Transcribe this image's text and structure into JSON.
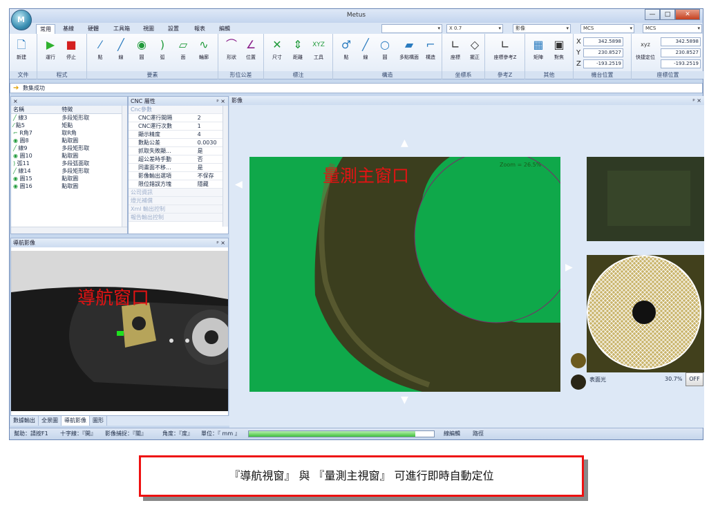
{
  "window": {
    "title": "Metus",
    "app_logo": "M"
  },
  "window_controls": {
    "minimize": "—",
    "maximize": "□",
    "close": "✕"
  },
  "tabs": [
    "常用",
    "基線",
    "硬體",
    "工具箱",
    "視圖",
    "設置",
    "報表",
    "編輯"
  ],
  "combos": {
    "layer": "",
    "x_value": "X  0.7",
    "image_mode": "影像",
    "mcs1": "MCS",
    "mcs2": "MCS"
  },
  "ribbon": {
    "groups": [
      {
        "label": "文件",
        "buttons": [
          "新建",
          "",
          ""
        ]
      },
      {
        "label": "程式",
        "buttons": [
          "運行",
          "停止"
        ]
      },
      {
        "label": "要素",
        "buttons": [
          "點",
          "線",
          "圓",
          "弧",
          "面",
          "輪廓"
        ]
      },
      {
        "label": "形位公差",
        "buttons": [
          "形狀",
          "位置"
        ]
      },
      {
        "label": "標注",
        "buttons": [
          "尺寸",
          "距離",
          "工具"
        ]
      },
      {
        "label": "構造",
        "buttons": [
          "點",
          "線",
          "圓",
          "多點構面",
          "構造"
        ]
      },
      {
        "label": "坐標系",
        "buttons": [
          "座標",
          "擺正"
        ]
      },
      {
        "label": "參考Z",
        "buttons": [
          "座標參考Z"
        ]
      },
      {
        "label": "其他",
        "buttons": [
          "矩陣",
          "對焦"
        ]
      }
    ],
    "machine_position": {
      "label": "機台位置",
      "x": "342.5898",
      "y": "230.8527",
      "z": "-193.2519"
    },
    "coord_position": {
      "label": "座標位置",
      "button": "快捷定位",
      "x": "342.5898",
      "y": "230.8527",
      "z": "-193.2519"
    }
  },
  "message": "數集成功",
  "feature_list": {
    "headers": [
      "名稱",
      "特徵"
    ],
    "rows": [
      {
        "name": "線3",
        "type": "多段矩形取"
      },
      {
        "name": "點5",
        "type": "矩點"
      },
      {
        "name": "R角7",
        "type": "取R角"
      },
      {
        "name": "圓8",
        "type": "點取圓"
      },
      {
        "name": "線9",
        "type": "多段矩形取"
      },
      {
        "name": "圓10",
        "type": "點取圓"
      },
      {
        "name": "弧11",
        "type": "多段弧面取"
      },
      {
        "name": "線14",
        "type": "多段矩形取"
      },
      {
        "name": "圓15",
        "type": "點取圓"
      },
      {
        "name": "圓16",
        "type": "點取圓"
      }
    ]
  },
  "cnc_panel": {
    "title": "CNC 屬性",
    "section": "Cnc參數",
    "rows": [
      {
        "k": "CNC運行間隔",
        "v": "2"
      },
      {
        "k": "CNC運行次數",
        "v": "1"
      },
      {
        "k": "顯示精度",
        "v": "4"
      },
      {
        "k": "數點公差",
        "v": "0.0030"
      },
      {
        "k": "抓取失敗顯...",
        "v": "是"
      },
      {
        "k": "超公差時手動",
        "v": "否"
      },
      {
        "k": "同畫面不移...",
        "v": "是"
      },
      {
        "k": "影像輸出選項",
        "v": "不保存"
      },
      {
        "k": "限位錯誤方塊",
        "v": "隱藏"
      }
    ],
    "sections": [
      "公司資訊",
      "燈光補償",
      "Xml 輸出控制",
      "報告輸出控制"
    ]
  },
  "nav_panel": {
    "title": "導航影像",
    "overlay": "導航窗口"
  },
  "image_panel": {
    "title": "影像",
    "overlay": "量測主窗口",
    "zoom": "Zoom = 26.5%"
  },
  "light": {
    "label": "表面光",
    "value": "30.7%",
    "button": "OFF"
  },
  "bottom_tabs": [
    "數據輸出",
    "全景圖",
    "導航影像",
    "圖形"
  ],
  "status": {
    "help": "幫助：請按F1",
    "crosshair": "十字線：『開』",
    "snap": "影像捕捉：『關』",
    "angle": "角度：『度』",
    "unit": "單位：『 mm 』",
    "progress": 0.9,
    "mode1": "線編輯",
    "mode2": "路徑"
  },
  "caption": "『導航視窗』 與 『量測主視窗』 可進行即時自動定位",
  "colors": {
    "accent": "#e11",
    "image_green": "#0fa84a"
  }
}
